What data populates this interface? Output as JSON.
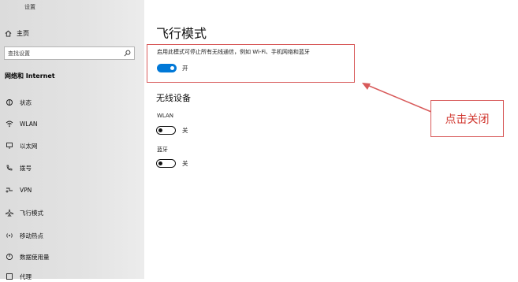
{
  "window": {
    "title": "设置"
  },
  "sidebar": {
    "home_label": "主页",
    "search_placeholder": "查找设置",
    "section_title": "网络和 Internet",
    "items": [
      {
        "label": "状态",
        "icon": "status-icon"
      },
      {
        "label": "WLAN",
        "icon": "wifi-icon"
      },
      {
        "label": "以太网",
        "icon": "ethernet-icon"
      },
      {
        "label": "拨号",
        "icon": "dialup-icon"
      },
      {
        "label": "VPN",
        "icon": "vpn-icon"
      },
      {
        "label": "飞行模式",
        "icon": "airplane-icon"
      },
      {
        "label": "移动热点",
        "icon": "hotspot-icon"
      },
      {
        "label": "数据使用量",
        "icon": "data-usage-icon"
      },
      {
        "label": "代理",
        "icon": "proxy-icon"
      }
    ]
  },
  "main": {
    "title": "飞行模式",
    "description": "启用此模式可停止所有无线通信，例如 Wi-Fi、手机网络和蓝牙",
    "airplane_toggle": {
      "state": "on",
      "state_label": "开"
    },
    "wireless_section_title": "无线设备",
    "wlan": {
      "label": "WLAN",
      "state": "off",
      "state_label": "关"
    },
    "bluetooth": {
      "label": "蓝牙",
      "state": "off",
      "state_label": "关"
    }
  },
  "annotation": {
    "callout_text": "点击关闭",
    "color": "#d85a5a"
  },
  "colors": {
    "accent": "#0078d7",
    "sidebar_bg": "#e3e3e3"
  }
}
